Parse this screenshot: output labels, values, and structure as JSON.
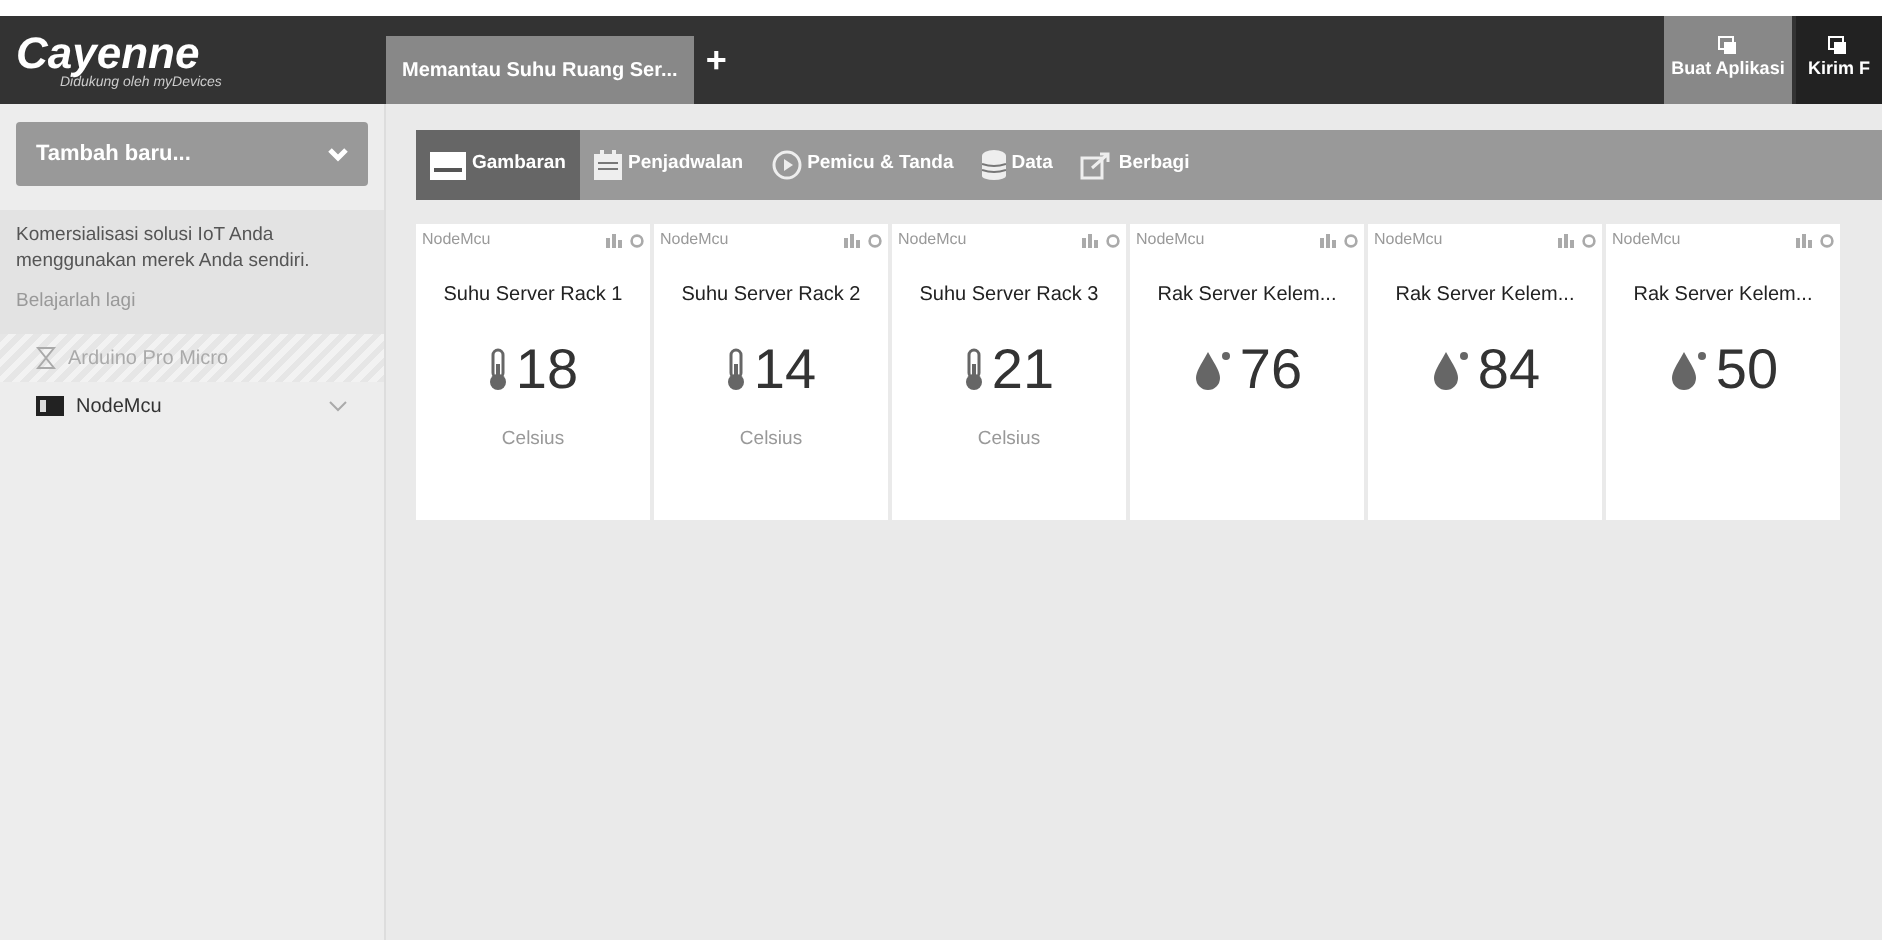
{
  "header": {
    "logo": "Cayenne",
    "tagline": "Didukung oleh myDevices",
    "project_tab": {
      "label": "Memantau Suhu Ruang Ser...",
      "selected": true
    },
    "add_tab": "+",
    "actions": [
      {
        "label": "Buat Aplikasi",
        "selected": true
      },
      {
        "label": "Kirim F",
        "selected": false
      }
    ]
  },
  "sidebar": {
    "add_button": "Tambah baru...",
    "promo": {
      "text": "Komersialisasi solusi IoT Anda menggunakan merek Anda sendiri.",
      "link": "Belajarlah lagi"
    },
    "devices": [
      {
        "name": "Arduino Pro Micro",
        "disabled": true
      },
      {
        "name": "NodeMcu",
        "disabled": false
      }
    ]
  },
  "toolbar": [
    {
      "label": "Gambaran",
      "kind": "overview",
      "selected": true
    },
    {
      "label": "Penjadwalan",
      "kind": "schedule",
      "selected": false
    },
    {
      "label": "Pemicu & Tanda",
      "kind": "trigger",
      "selected": false
    },
    {
      "label": "Data",
      "kind": "data",
      "selected": false
    },
    {
      "label": "Berbagi",
      "kind": "share",
      "selected": false
    }
  ],
  "widgets": [
    {
      "device": "NodeMcu",
      "title": "Suhu Server Rack 1",
      "kind": "temperature",
      "value": "18",
      "unit": "Celsius"
    },
    {
      "device": "NodeMcu",
      "title": "Suhu Server Rack 2",
      "kind": "temperature",
      "value": "14",
      "unit": "Celsius"
    },
    {
      "device": "NodeMcu",
      "title": "Suhu Server Rack 3",
      "kind": "temperature",
      "value": "21",
      "unit": "Celsius"
    },
    {
      "device": "NodeMcu",
      "title": "Rak Server Kelem...",
      "kind": "humidity",
      "value": "76"
    },
    {
      "device": "NodeMcu",
      "title": "Rak Server Kelem...",
      "kind": "humidity",
      "value": "84"
    },
    {
      "device": "NodeMcu",
      "title": "Rak Server Kelem...",
      "kind": "humidity",
      "value": "50"
    }
  ]
}
